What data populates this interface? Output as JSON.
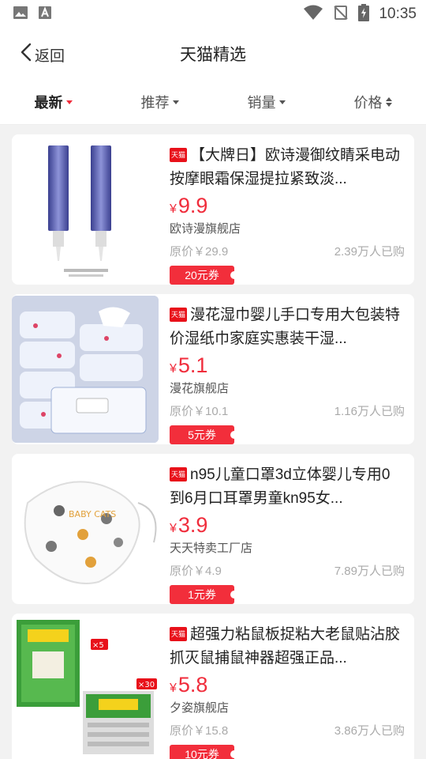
{
  "status_bar": {
    "time": "10:35",
    "left_icons": [
      "image-icon",
      "text-a-icon"
    ],
    "right_icons": [
      "wifi-icon",
      "no-signal-icon",
      "battery-charging-icon"
    ]
  },
  "header": {
    "back_label": "返回",
    "title": "天猫精选"
  },
  "sort_tabs": [
    {
      "label": "最新",
      "active": true
    },
    {
      "label": "推荐",
      "active": false
    },
    {
      "label": "销量",
      "active": false
    },
    {
      "label": "价格",
      "active": false
    }
  ],
  "badge_text": "天猫",
  "products": [
    {
      "title": "【大牌日】欧诗漫御纹睛采电动按摩眼霜保湿提拉紧致淡...",
      "currency": "¥",
      "price": "9.9",
      "shop": "欧诗漫旗舰店",
      "original_price": "原价￥29.9",
      "sold": "2.39万人已购",
      "coupon": "20元券"
    },
    {
      "title": "漫花湿巾婴儿手口专用大包装特价湿纸巾家庭实惠装干湿...",
      "currency": "¥",
      "price": "5.1",
      "shop": "漫花旗舰店",
      "original_price": "原价￥10.1",
      "sold": "1.16万人已购",
      "coupon": "5元券"
    },
    {
      "title": "n95儿童口罩3d立体婴儿专用0到6月口耳罩男童kn95女...",
      "currency": "¥",
      "price": "3.9",
      "shop": "天天特卖工厂店",
      "original_price": "原价￥4.9",
      "sold": "7.89万人已购",
      "coupon": "1元券"
    },
    {
      "title": "超强力粘鼠板捉粘大老鼠贴沾胶抓灭鼠捕鼠神器超强正品...",
      "currency": "¥",
      "price": "5.8",
      "shop": "夕姿旗舰店",
      "original_price": "原价￥15.8",
      "sold": "3.86万人已购",
      "coupon": "10元券"
    }
  ],
  "image_text": {
    "p4_badge_small": "×5",
    "p4_badge_large": "×30",
    "p3_print": "BABY CATS"
  },
  "colors": {
    "accent": "#f02d3c",
    "tmall_red": "#e8111a",
    "background": "#f2f2f2"
  }
}
